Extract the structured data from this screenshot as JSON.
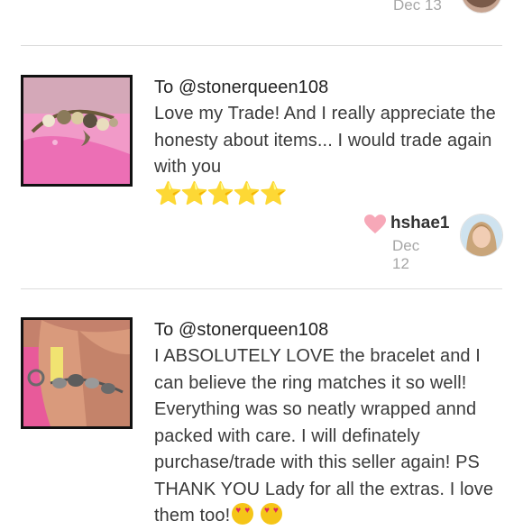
{
  "previous": {
    "date": "Dec 13"
  },
  "reviews": [
    {
      "to": "To @stonerqueen108",
      "text": "Love my Trade! And I really appreciate the honesty about items... I would trade again with you",
      "stars": "⭐⭐⭐⭐⭐",
      "author": "hshae1",
      "date": "Dec 12"
    },
    {
      "to": "To @stonerqueen108",
      "text": "I ABSOLUTELY LOVE the bracelet and I can believe the ring matches it so well! Everything was so neatly wrapped annd packed with care. I will definately purchase/trade with this seller again! PS THANK YOU Lady for all the extras. I love them too!",
      "emojis": [
        "heart-eyes",
        "heart-eyes"
      ]
    }
  ],
  "colors": {
    "heart": "#f7a8b8",
    "star": "#f3c623",
    "muted": "#a6a6a6"
  }
}
